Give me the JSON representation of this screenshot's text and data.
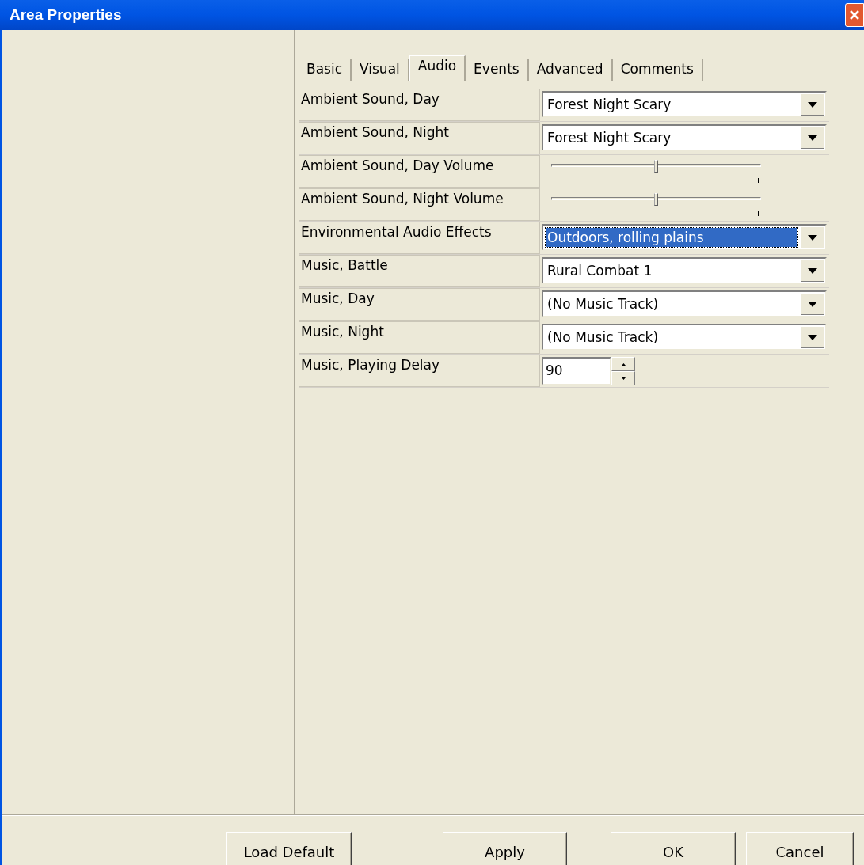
{
  "window": {
    "title": "Area Properties"
  },
  "tabs": [
    {
      "label": "Basic",
      "selected": false
    },
    {
      "label": "Visual",
      "selected": false
    },
    {
      "label": "Audio",
      "selected": true
    },
    {
      "label": "Events",
      "selected": false
    },
    {
      "label": "Advanced",
      "selected": false
    },
    {
      "label": "Comments",
      "selected": false
    }
  ],
  "properties": [
    {
      "kind": "combo",
      "label": "Ambient Sound, Day",
      "value": "Forest Night Scary",
      "selected": false
    },
    {
      "kind": "combo",
      "label": "Ambient Sound, Night",
      "value": "Forest Night Scary",
      "selected": false
    },
    {
      "kind": "slider",
      "label": "Ambient Sound, Day Volume",
      "level": 0.49
    },
    {
      "kind": "slider",
      "label": "Ambient Sound, Night Volume",
      "level": 0.49
    },
    {
      "kind": "combo",
      "label": "Environmental Audio Effects",
      "value": "Outdoors, rolling plains",
      "selected": true
    },
    {
      "kind": "combo",
      "label": "Music, Battle",
      "value": "Rural Combat 1",
      "selected": false
    },
    {
      "kind": "combo",
      "label": "Music, Day",
      "value": "(No Music Track)",
      "selected": false
    },
    {
      "kind": "combo",
      "label": "Music, Night",
      "value": "(No Music Track)",
      "selected": false
    },
    {
      "kind": "spin",
      "label": "Music, Playing Delay",
      "value": "90"
    }
  ],
  "buttons": [
    "Load Default",
    "Apply",
    "OK",
    "Cancel"
  ]
}
